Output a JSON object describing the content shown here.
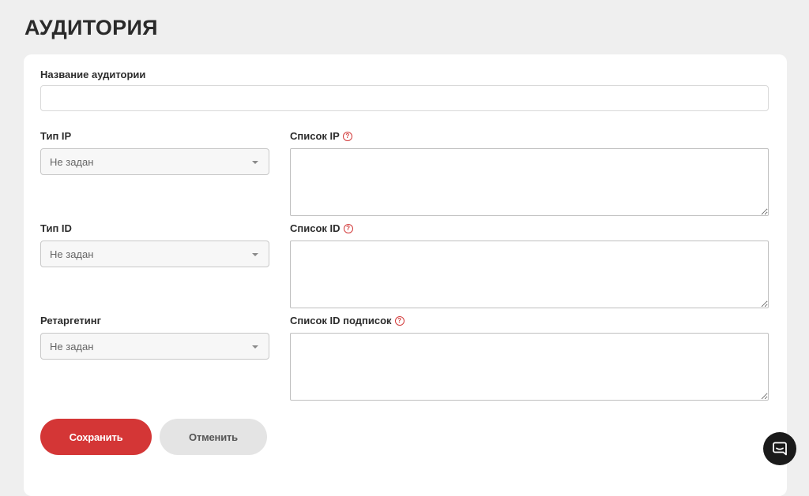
{
  "page": {
    "title": "АУДИТОРИЯ"
  },
  "form": {
    "audience_name": {
      "label": "Название аудитории",
      "value": "",
      "placeholder": ""
    },
    "ip_type": {
      "label": "Тип IP",
      "value": "Не задан"
    },
    "ip_list": {
      "label": "Список IP",
      "value": ""
    },
    "id_type": {
      "label": "Тип ID",
      "value": "Не задан"
    },
    "id_list": {
      "label": "Список ID",
      "value": ""
    },
    "retargeting": {
      "label": "Ретаргетинг",
      "value": "Не задан"
    },
    "subscription_id_list": {
      "label": "Список ID подписок",
      "value": ""
    },
    "help_glyph": "?"
  },
  "actions": {
    "save_label": "Сохранить",
    "cancel_label": "Отменить"
  },
  "colors": {
    "accent": "#d43636",
    "help": "#d23a3a",
    "background": "#efefef"
  },
  "icons": {
    "help": "question-circle-icon",
    "dropdown": "caret-down-icon",
    "chat": "chat-bubble-icon"
  }
}
